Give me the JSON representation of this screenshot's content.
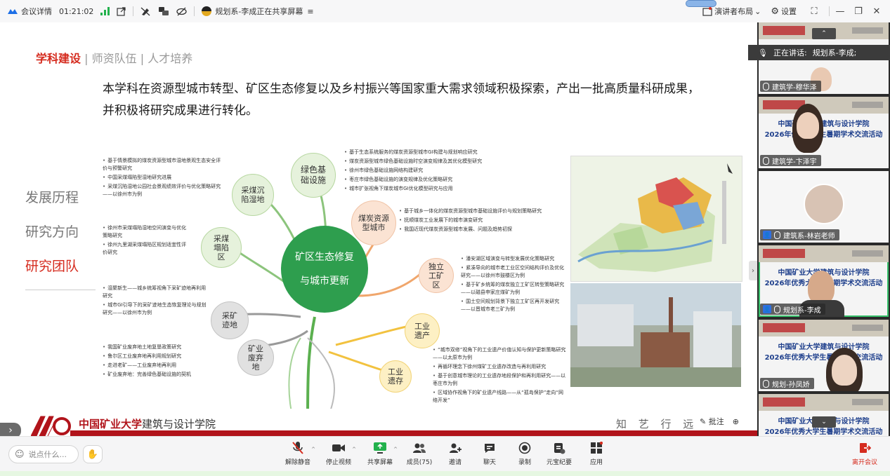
{
  "topbar": {
    "meeting_details": "会议详情",
    "elapsed": "01:21:02",
    "share_status": "规划系-李成正在共享屏幕",
    "layout_label": "演讲者布局",
    "settings_label": "设置"
  },
  "slide": {
    "tabs": [
      "学科建设",
      "师资队伍",
      "人才培养"
    ],
    "tab_sep": "|",
    "intro": "本学科在资源型城市转型、矿区生态修复以及乡村振兴等国家重大需求领域积极探索，产出一批高质量科研成果，并积极将研究成果进行转化。",
    "nav": [
      "发展历程",
      "研究方向",
      "研究团队"
    ],
    "center_line1": "矿区生态修复",
    "center_line2": "与城市更新",
    "nodes": {
      "green_infra": "绿色基础设施",
      "subsidence_wetland": "采煤沉陷湿地",
      "subsidence_area": "采煤塌陷区",
      "coal_city": "煤炭资源型城市",
      "independent_mine": "独立工矿区",
      "industrial_heritage": "工业遗产",
      "industrial_relic": "工业遗存",
      "mining_relic": "采矿迹地",
      "abandoned_mine": "矿业废弃地"
    },
    "bullets": {
      "wetland": [
        "基于情景模拟的煤炭资源型城市湿地景观生态安全评价与预警研究",
        "中国采煤塌陷型湿地研究进展",
        "采煤沉陷湿地公园社会景观绩效评价与优化策略研究——以徐州市为例"
      ],
      "collapse": [
        "徐州市采煤塌陷湿地空间演变与优化策略研究",
        "徐州九里湖采煤塌陷区规划适宜性评价研究"
      ],
      "mining_relic": [
        "湿聚新生——城乡统筹视角下采矿迹地再利用研究",
        "城市GI引导下的采矿迹地生态恢复理论与规划研究——以徐州市为例"
      ],
      "abandoned": [
        "我国矿业废弃地土地复垦政策研究",
        "鲁尔区工业废弃地再利用规划研究",
        "走进老矿——工业废弃地再利用",
        "矿业废弃地：完善绿色基础设施的契机"
      ],
      "green": [
        "基于生态系统服务的煤炭资源型城市GI构建与规划响应研究",
        "煤炭资源型城市绿色基础设施时空演变规律及其优化模型研究",
        "徐州市绿色基础设施网络构建研究",
        "枣庄市绿色基础设施的演变规律及优化策略研究",
        "城市扩张视角下煤炭城市GI优化模型研究与应用"
      ],
      "coal_city": [
        "基于城乡一体化的煤炭资源型城市基础设施评价与规划策略研究",
        "抚顺煤炭工业发展下的城市演变研究",
        "我国近现代煤炭资源型城市发展、问题及趋势初探"
      ],
      "independent": [
        "潘安湖区域演变与转型发展优化策略研究",
        "紧凑导向的城市老工业区空间结构评价及优化研究——以徐州市鼓楼区为例",
        "基于矿乡统筹的煤炭独立工矿区转型策略研究——以磁县申家庄煤矿为例",
        "国土空间规划背景下独立工矿区再开发研究——以晋城市老三矿为例"
      ],
      "heritage": [
        "“城市双修”视角下的工业遗产价值认知与保护更新策略研究——以太原市为例",
        "再循环理念下徐州煤矿工业遗存改造与再利用研究",
        "基于创意城市理论的工业遗存地段保护和再利用研究——以枣庄市为例",
        "区域协作视角下的矿业遗产线路——从“孤岛保护”走向“网络开发”"
      ]
    },
    "footer_school_bold": "中国矿业大学",
    "footer_school_rest": "建筑与设计学院",
    "footer_motto": "知 艺 行 远 · 设",
    "annot_label": "批注"
  },
  "participants": {
    "speaking_label": "正在讲话:",
    "speaking_name": "规划系-李成;",
    "banner_line1": "中国矿业大学建筑与设计学院",
    "banner_line2": "2026年优秀大学生暑期学术交流活动",
    "tiles": [
      {
        "name": "建筑学-穆华泽"
      },
      {
        "name": "建筑学-卞泽宇"
      },
      {
        "name": "建筑系-林岩老师"
      },
      {
        "name": "规划系-李成"
      },
      {
        "name": "规划-孙凤娇"
      }
    ]
  },
  "toolbar": {
    "say_placeholder": "说点什么...",
    "buttons": [
      {
        "label": "解除静音"
      },
      {
        "label": "停止视频"
      },
      {
        "label": "共享屏幕"
      },
      {
        "label": "成员(75)"
      },
      {
        "label": "邀请"
      },
      {
        "label": "聊天"
      },
      {
        "label": "录制"
      },
      {
        "label": "元宝纪要"
      },
      {
        "label": "应用"
      }
    ],
    "leave_label": "离开会议"
  },
  "colors": {
    "accent_red": "#d52b1e",
    "brand_red": "#b1141b",
    "green": "#2e9e4e",
    "active_tile": "#36c06a"
  }
}
